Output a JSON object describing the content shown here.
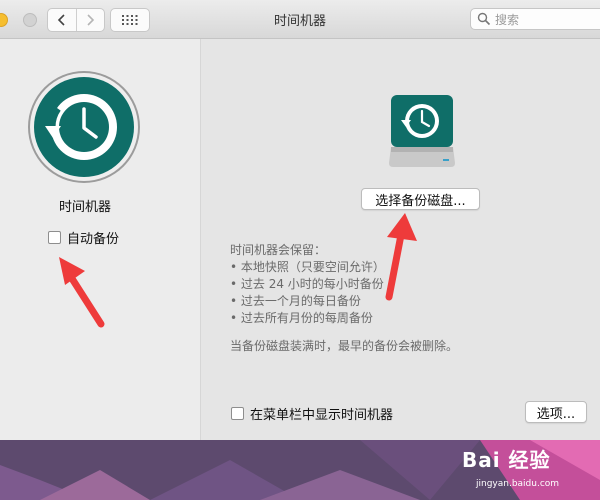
{
  "window": {
    "title": "时间机器",
    "search_placeholder": "搜索"
  },
  "sidebar": {
    "title": "时间机器",
    "auto_backup_label": "自动备份",
    "auto_backup_checked": false
  },
  "main": {
    "select_disk_button": "选择备份磁盘...",
    "keeps_title": "时间机器会保留：",
    "keeps_items": [
      "本地快照（只要空间允许）",
      "过去 24 小时的每小时备份",
      "过去一个月的每日备份",
      "过去所有月份的每周备份"
    ],
    "note": "当备份磁盘装满时，最早的备份会被删除。",
    "menubar_checkbox_label": "在菜单栏中显示时间机器",
    "menubar_checkbox_checked": false,
    "options_button": "选项..."
  },
  "watermark": {
    "brand": "Bai 经验",
    "url": "jingyan.baidu.com"
  },
  "colors": {
    "teal": "#0f6e68",
    "arrow_red": "#ee3b3b"
  },
  "icons": [
    "back-icon",
    "forward-icon",
    "grid-icon",
    "search-icon",
    "time-machine-icon",
    "time-machine-disk-icon"
  ]
}
